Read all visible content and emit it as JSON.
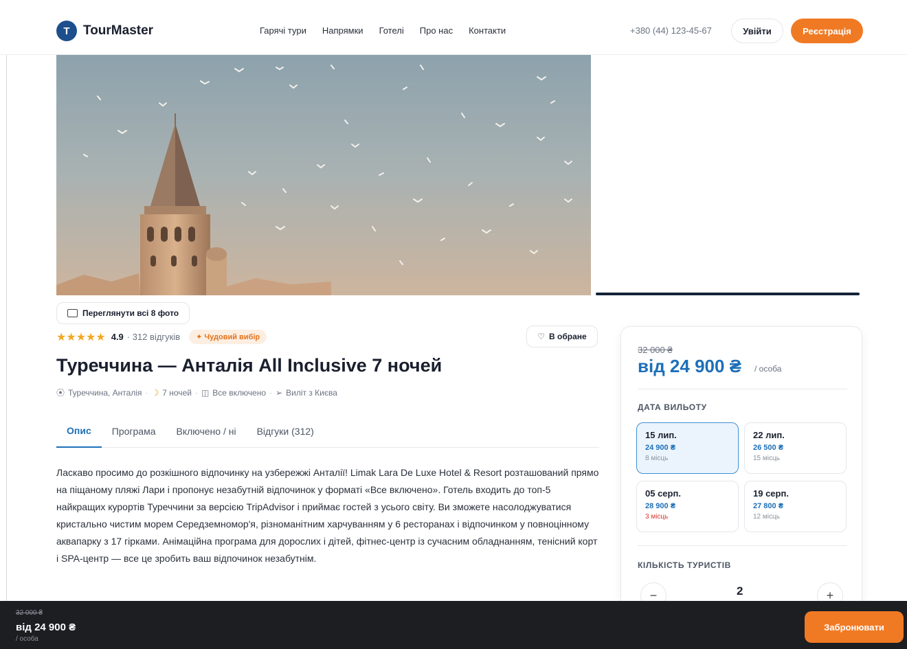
{
  "header": {
    "logo_letter": "T",
    "logo_text": "TourMaster",
    "nav": [
      "Гарячі тури",
      "Напрямки",
      "Готелі",
      "Про нас",
      "Контакти"
    ],
    "phone": "+380 (44) 123-45-67",
    "login_label": "Увійти",
    "register_label": "Реєстрація"
  },
  "gallery": {
    "view_all_label": "Переглянути всі 8 фото"
  },
  "tour": {
    "stars": "★★★★★",
    "rating": "4.9",
    "reviews": "· 312 відгуків",
    "badge": "✦ Чудовий вибір",
    "favorite_label": "В обране",
    "title": "Туреччина — Анталія All Inclusive 7 ночей",
    "meta": {
      "location": "Туреччина, Анталія",
      "nights": "7 ночей",
      "board": "Все включено",
      "departure": "Виліт з Києва"
    },
    "tabs": [
      "Опис",
      "Програма",
      "Включено / ні",
      "Відгуки (312)"
    ],
    "description": "Ласкаво просимо до розкішного відпочинку на узбережжі Анталії! Limak Lara De Luxe Hotel & Resort розташований прямо на піщаному пляжі Лари і пропонує незабутній відпочинок у форматі «Все включено». Готель входить до топ-5 найкращих курортів Туреччини за версією TripAdvisor і приймає гостей з усього світу. Ви зможете насолоджуватися кристально чистим морем Середземномор'я, різноманітним харчуванням у 6 ресторанах і відпочинком у повноцінному аквапарку з 17 гірками. Анімаційна програма для дорослих і дітей, фітнес-центр із сучасним обладнанням, тенісний корт і SPA-центр — все це зробить ваш відпочинок незабутнім."
  },
  "booking": {
    "old_price": "32 000 ₴",
    "price": "від 24 900 ₴",
    "per_person": "/ особа",
    "dates_label": "ДАТА ВИЛЬОТУ",
    "dates": [
      {
        "date": "15 лип.",
        "price": "24 900 ₴",
        "seats": "8 місць"
      },
      {
        "date": "22 лип.",
        "price": "26 500 ₴",
        "seats": "15 місць"
      },
      {
        "date": "05 серп.",
        "price": "28 900 ₴",
        "seats": "3 місць"
      },
      {
        "date": "19 серп.",
        "price": "27 800 ₴",
        "seats": "12 місць"
      }
    ],
    "tourists_label": "КІЛЬКІСТЬ ТУРИСТІВ",
    "tourists_count": "2",
    "minus": "−",
    "plus": "+"
  },
  "bottom_bar": {
    "old_price": "32 000 ₴",
    "price": "від 24 900 ₴",
    "per_person": "/ особа",
    "book_label": "Забронювати"
  }
}
